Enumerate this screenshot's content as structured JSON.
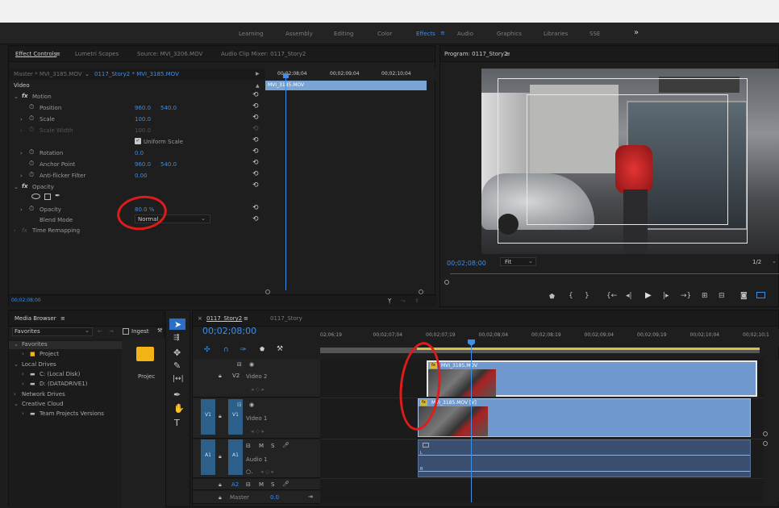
{
  "workspaces": [
    {
      "label": "Learning",
      "active": false
    },
    {
      "label": "Assembly",
      "active": false
    },
    {
      "label": "Editing",
      "active": false
    },
    {
      "label": "Color",
      "active": false
    },
    {
      "label": "Effects",
      "active": true
    },
    {
      "label": "Audio",
      "active": false
    },
    {
      "label": "Graphics",
      "active": false
    },
    {
      "label": "Libraries",
      "active": false
    },
    {
      "label": "SSE",
      "active": false
    }
  ],
  "workspace_menu_icon": "≡",
  "workspace_more_icon": "»",
  "effect_controls": {
    "tabs": [
      "Effect Controls",
      "Lumetri Scopes",
      "Source: MVI_3206.MOV",
      "Audio Clip Mixer: 0117_Story2"
    ],
    "menu_icon": "≡",
    "master_label": "Master * MVI_3185.MOV",
    "sequence_clip": "0117_Story2 * MVI_3185.MOV",
    "video_header": "Video",
    "timecodes": [
      "00;02;08;04",
      "00;02;09;04",
      "00;02;10;04"
    ],
    "clip_label": "MVI_3185.MOV",
    "motion": "Motion",
    "position_label": "Position",
    "position_x": "960.0",
    "position_y": "540.0",
    "scale_label": "Scale",
    "scale_value": "100.0",
    "scale_width_label": "Scale Width",
    "scale_width_value": "100.0",
    "uniform_scale": "Uniform Scale",
    "rotation_label": "Rotation",
    "rotation_value": "0.0",
    "anchor_label": "Anchor Point",
    "anchor_x": "960.0",
    "anchor_y": "540.0",
    "antiflicker_label": "Anti-flicker Filter",
    "antiflicker_value": "0.00",
    "opacity_header": "Opacity",
    "opacity_label": "Opacity",
    "opacity_value": "80.0 %",
    "blend_label": "Blend Mode",
    "blend_value": "Normal",
    "time_remap": "Time Remapping",
    "current_time": "00;02;08;00"
  },
  "program": {
    "title": "Program: 0117_Story2",
    "menu_icon": "≡",
    "timecode": "00;02;08;00",
    "fit": "Fit",
    "resolution": "1/2"
  },
  "media_browser": {
    "tab": "Media Browser",
    "menu_icon": "≡",
    "favorites_select": "Favorites",
    "ingest": "Ingest",
    "tree": [
      {
        "label": "Favorites",
        "indent": 0,
        "arrow": "⌄"
      },
      {
        "label": "Project",
        "indent": 2,
        "arrow": "›"
      },
      {
        "label": "Local Drives",
        "indent": 0,
        "arrow": "⌄"
      },
      {
        "label": "C: (Local Disk)",
        "indent": 2,
        "arrow": "›"
      },
      {
        "label": "D: (DATADRIVE1)",
        "indent": 2,
        "arrow": "›"
      },
      {
        "label": "Network Drives",
        "indent": 0,
        "arrow": "›"
      },
      {
        "label": "Creative Cloud",
        "indent": 0,
        "arrow": "⌄"
      },
      {
        "label": "Team Projects Versions",
        "indent": 2,
        "arrow": "›"
      }
    ],
    "folder_label": "Projec"
  },
  "timeline": {
    "tabs": [
      "0117_Story2",
      "0117_Story"
    ],
    "menu_icon": "≡",
    "timecode": "00;02;08;00",
    "ruler": [
      "02;06;19",
      "00;02;07;04",
      "00;02;07;19",
      "00;02;08;04",
      "00;02;08;19",
      "00;02;09;04",
      "00;02;09;19",
      "00;02;10;04",
      "00;02;10;1"
    ],
    "tracks": {
      "v2": "V2",
      "v2_name": "Video 2",
      "v1_src": "V1",
      "v1": "V1",
      "v1_name": "Video 1",
      "a1_src": "A1",
      "a1": "A1",
      "a1_name": "Audio 1",
      "a2": "A2",
      "master": "Master",
      "master_value": "0.0",
      "m": "M",
      "s": "S"
    },
    "clip_v2": "MVI_3185.MOV",
    "clip_v1": "MVI_3185.MOV [V]"
  }
}
